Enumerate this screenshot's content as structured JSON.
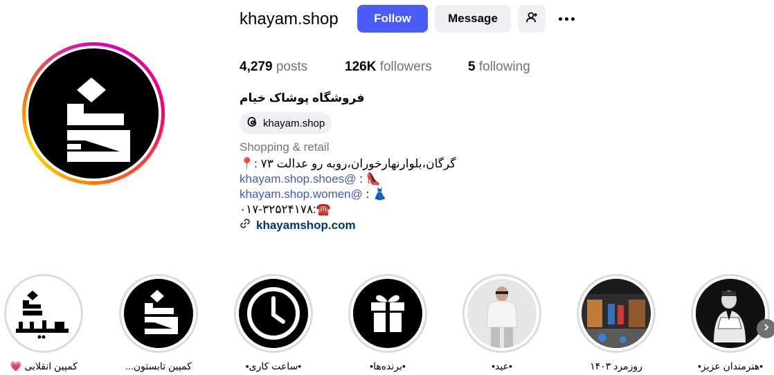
{
  "profile": {
    "username": "khayam.shop",
    "full_name": "فروشگاه پوشاک خیام",
    "threads_handle": "khayam.shop",
    "category": "Shopping & retail",
    "website": "khayamshop.com"
  },
  "actions": {
    "follow_label": "Follow",
    "message_label": "Message"
  },
  "stats": {
    "posts_count": "4,279",
    "posts_label": "posts",
    "followers_count": "126K",
    "followers_label": "followers",
    "following_count": "5",
    "following_label": "following"
  },
  "bio": {
    "address_emoji": "📍",
    "address": "گرگان،بلوارنهارخوران،روبه رو عدالت ۷۳ :",
    "shoes_emoji": "👠",
    "shoes_link": "khayam.shop.shoes@",
    "shoes_sep": " :",
    "women_emoji": "👗",
    "women_link": "khayam.shop.women@",
    "women_sep": " :",
    "phone_emoji": "☎️",
    "phone": "۰۱۷-۳۲۵۲۴۱۷۸:"
  },
  "highlights": [
    {
      "label": "کمپین انقلابی 💗",
      "icon": "khayam-wordmark"
    },
    {
      "label": "کمپین تابستون...",
      "icon": "khayam-logo"
    },
    {
      "label": "•ساعت کاری•",
      "icon": "clock-icon"
    },
    {
      "label": "•برنده‌ها•",
      "icon": "gift-icon"
    },
    {
      "label": "•عید•",
      "icon": "man-photo"
    },
    {
      "label": "روزمرد ۱۴۰۳",
      "icon": "store-photo"
    },
    {
      "label": "•هنرمندان عزیز•",
      "icon": "artist-sketch"
    }
  ],
  "colors": {
    "follow_button": "#4a5df9",
    "secondary_button": "#efeff3",
    "link": "#4057c8",
    "website": "#00376b",
    "muted_text": "#737373"
  }
}
